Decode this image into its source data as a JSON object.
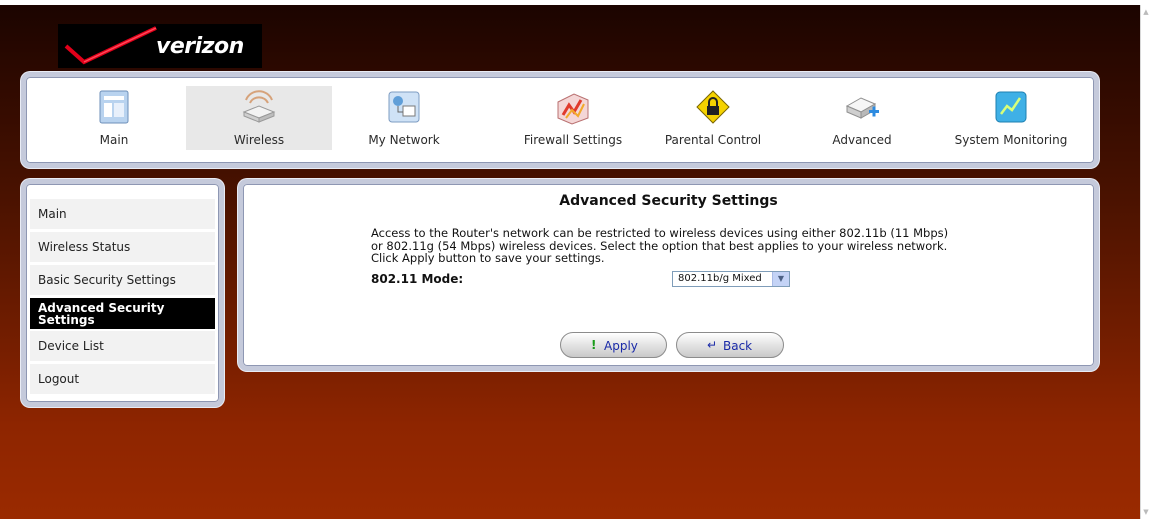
{
  "brand": {
    "name": "verizon"
  },
  "nav": {
    "items": [
      {
        "label": "Main",
        "icon": "main-page-icon"
      },
      {
        "label": "Wireless",
        "icon": "wireless-router-icon"
      },
      {
        "label": "My Network",
        "icon": "network-icon"
      },
      {
        "label": "Firewall Settings",
        "icon": "firewall-icon"
      },
      {
        "label": "Parental Control",
        "icon": "lock-sign-icon"
      },
      {
        "label": "Advanced",
        "icon": "advanced-settings-icon"
      },
      {
        "label": "System Monitoring",
        "icon": "system-monitor-icon"
      }
    ],
    "active": "Wireless"
  },
  "sidebar": {
    "items": [
      {
        "label": "Main"
      },
      {
        "label": "Wireless Status"
      },
      {
        "label": "Basic Security Settings"
      },
      {
        "label": "Advanced Security Settings"
      },
      {
        "label": "Device List"
      },
      {
        "label": "Logout"
      }
    ],
    "active": "Advanced Security Settings"
  },
  "content": {
    "title": "Advanced Security Settings",
    "description": "Access to the Router's network can be restricted to wireless devices using either 802.11b (11 Mbps) or 802.11g (54 Mbps) wireless devices. Select the option that best applies to your wireless network. Click Apply button to save your settings.",
    "mode_label": "802.11 Mode:",
    "mode_value": "802.11b/g Mixed"
  },
  "buttons": {
    "apply": "Apply",
    "back": "Back"
  },
  "colors": {
    "background_top": "#1a0400",
    "background_bottom": "#9a2a00",
    "panel_border": "#c5cadb",
    "active_sidebar": "#000000",
    "link_blue": "#1a2aa8"
  }
}
